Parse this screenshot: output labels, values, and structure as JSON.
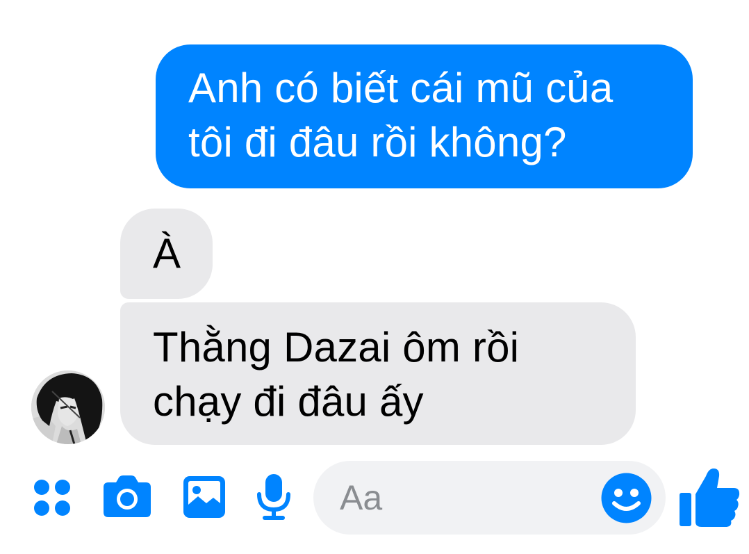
{
  "messages": [
    {
      "direction": "outgoing",
      "lines": [
        "Anh có biết cái mũ của",
        "tôi đi đâu rồi không?"
      ]
    },
    {
      "direction": "incoming",
      "lines": [
        "À"
      ]
    },
    {
      "direction": "incoming",
      "lines": [
        "Thằng Dazai ôm rồi",
        "chạy đi đâu ấy"
      ]
    }
  ],
  "composer": {
    "placeholder": "Aa",
    "icons": [
      "apps-icon",
      "camera-icon",
      "image-icon",
      "microphone-icon",
      "emoji-icon",
      "like-icon"
    ]
  },
  "colors": {
    "accent": "#0084ff",
    "outgoing_bubble": "#0084ff",
    "incoming_bubble": "#e9e9eb",
    "input_background": "#f1f2f4",
    "placeholder_text": "#8a8d91"
  }
}
